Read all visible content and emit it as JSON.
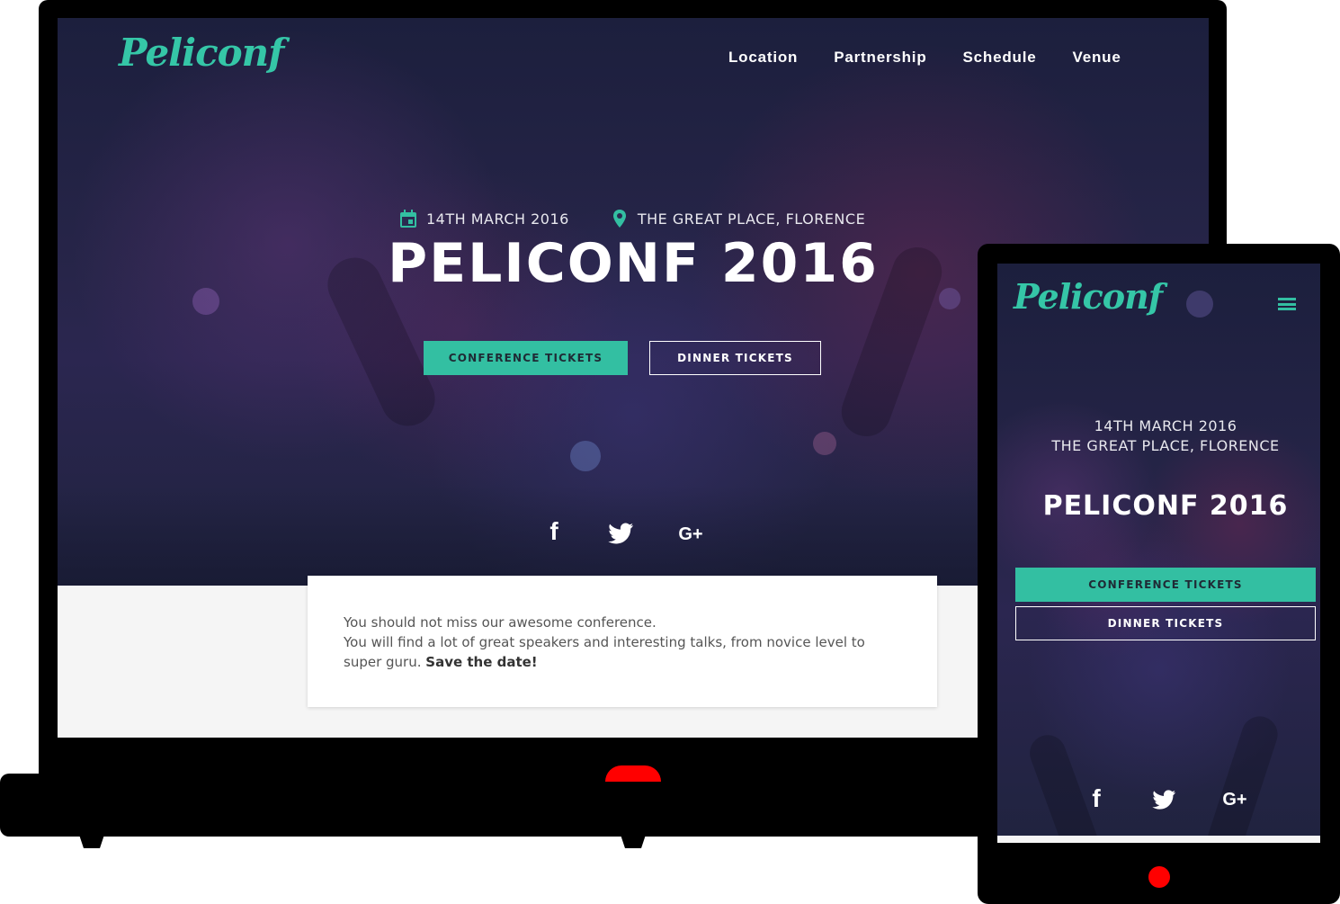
{
  "desktop": {
    "logo": "Peliconf",
    "nav": [
      "Location",
      "Partnership",
      "Schedule",
      "Venue"
    ],
    "date": "14TH MARCH 2016",
    "place": "THE GREAT PLACE, FLORENCE",
    "title": "PELICONF 2016",
    "buttons": {
      "conference": "CONFERENCE TICKETS",
      "dinner": "DINNER TICKETS"
    },
    "social": {
      "facebook": "f",
      "google": "G+"
    },
    "intro": {
      "line1": "You should not miss our awesome conference.",
      "line2": "You will find a lot of great speakers and interesting talks, from novice level to super guru.",
      "emphasis": "Save the date!"
    }
  },
  "mobile": {
    "logo": "Peliconf",
    "date": "14TH MARCH 2016",
    "place": "THE GREAT PLACE, FLORENCE",
    "title": "PELICONF 2016",
    "buttons": {
      "conference": "CONFERENCE TICKETS",
      "dinner": "DINNER TICKETS"
    },
    "social": {
      "facebook": "f",
      "google": "G+"
    }
  },
  "colors": {
    "accent": "#33bfa2",
    "hero_dark": "#1c1f3d",
    "device_indicator": "#ff0000"
  },
  "icons": [
    "calendar-icon",
    "location-pin-icon",
    "facebook-icon",
    "twitter-icon",
    "google-plus-icon",
    "hamburger-menu-icon"
  ]
}
